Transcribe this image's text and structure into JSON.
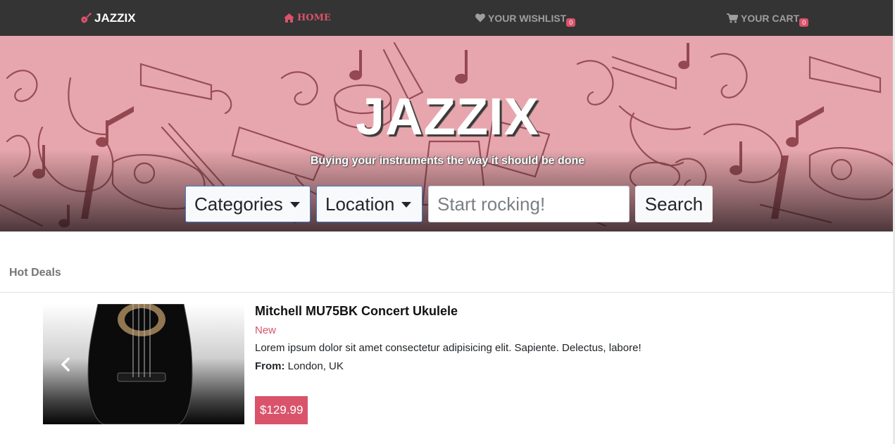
{
  "nav": {
    "brand": "JAZZIX",
    "home": "HOME",
    "wishlist": "YOUR WISHLIST",
    "wishlist_count": "0",
    "cart": "YOUR CART",
    "cart_count": "0",
    "icons": [
      "guitar-icon",
      "home-icon",
      "heart-icon",
      "cart-icon"
    ]
  },
  "hero": {
    "title": "JAZZIX",
    "subtitle": "Buying your instruments the way it should be done",
    "categories_label": "Categories",
    "location_label": "Location",
    "search_placeholder": "Start rocking!",
    "search_button": "Search"
  },
  "deals": {
    "heading": "Hot Deals",
    "product": {
      "title": "Mitchell MU75BK Concert Ukulele",
      "condition": "New",
      "description": "Lorem ipsum dolor sit amet consectetur adipisicing elit. Sapiente. Delectus, labore!",
      "from_label": "From:",
      "location": "London, UK",
      "price": "$129.99"
    }
  },
  "colors": {
    "navbar": "#343434",
    "accent": "#d9536b",
    "hero_bg": "#e7a6ad",
    "pattern": "#8b3e47"
  }
}
